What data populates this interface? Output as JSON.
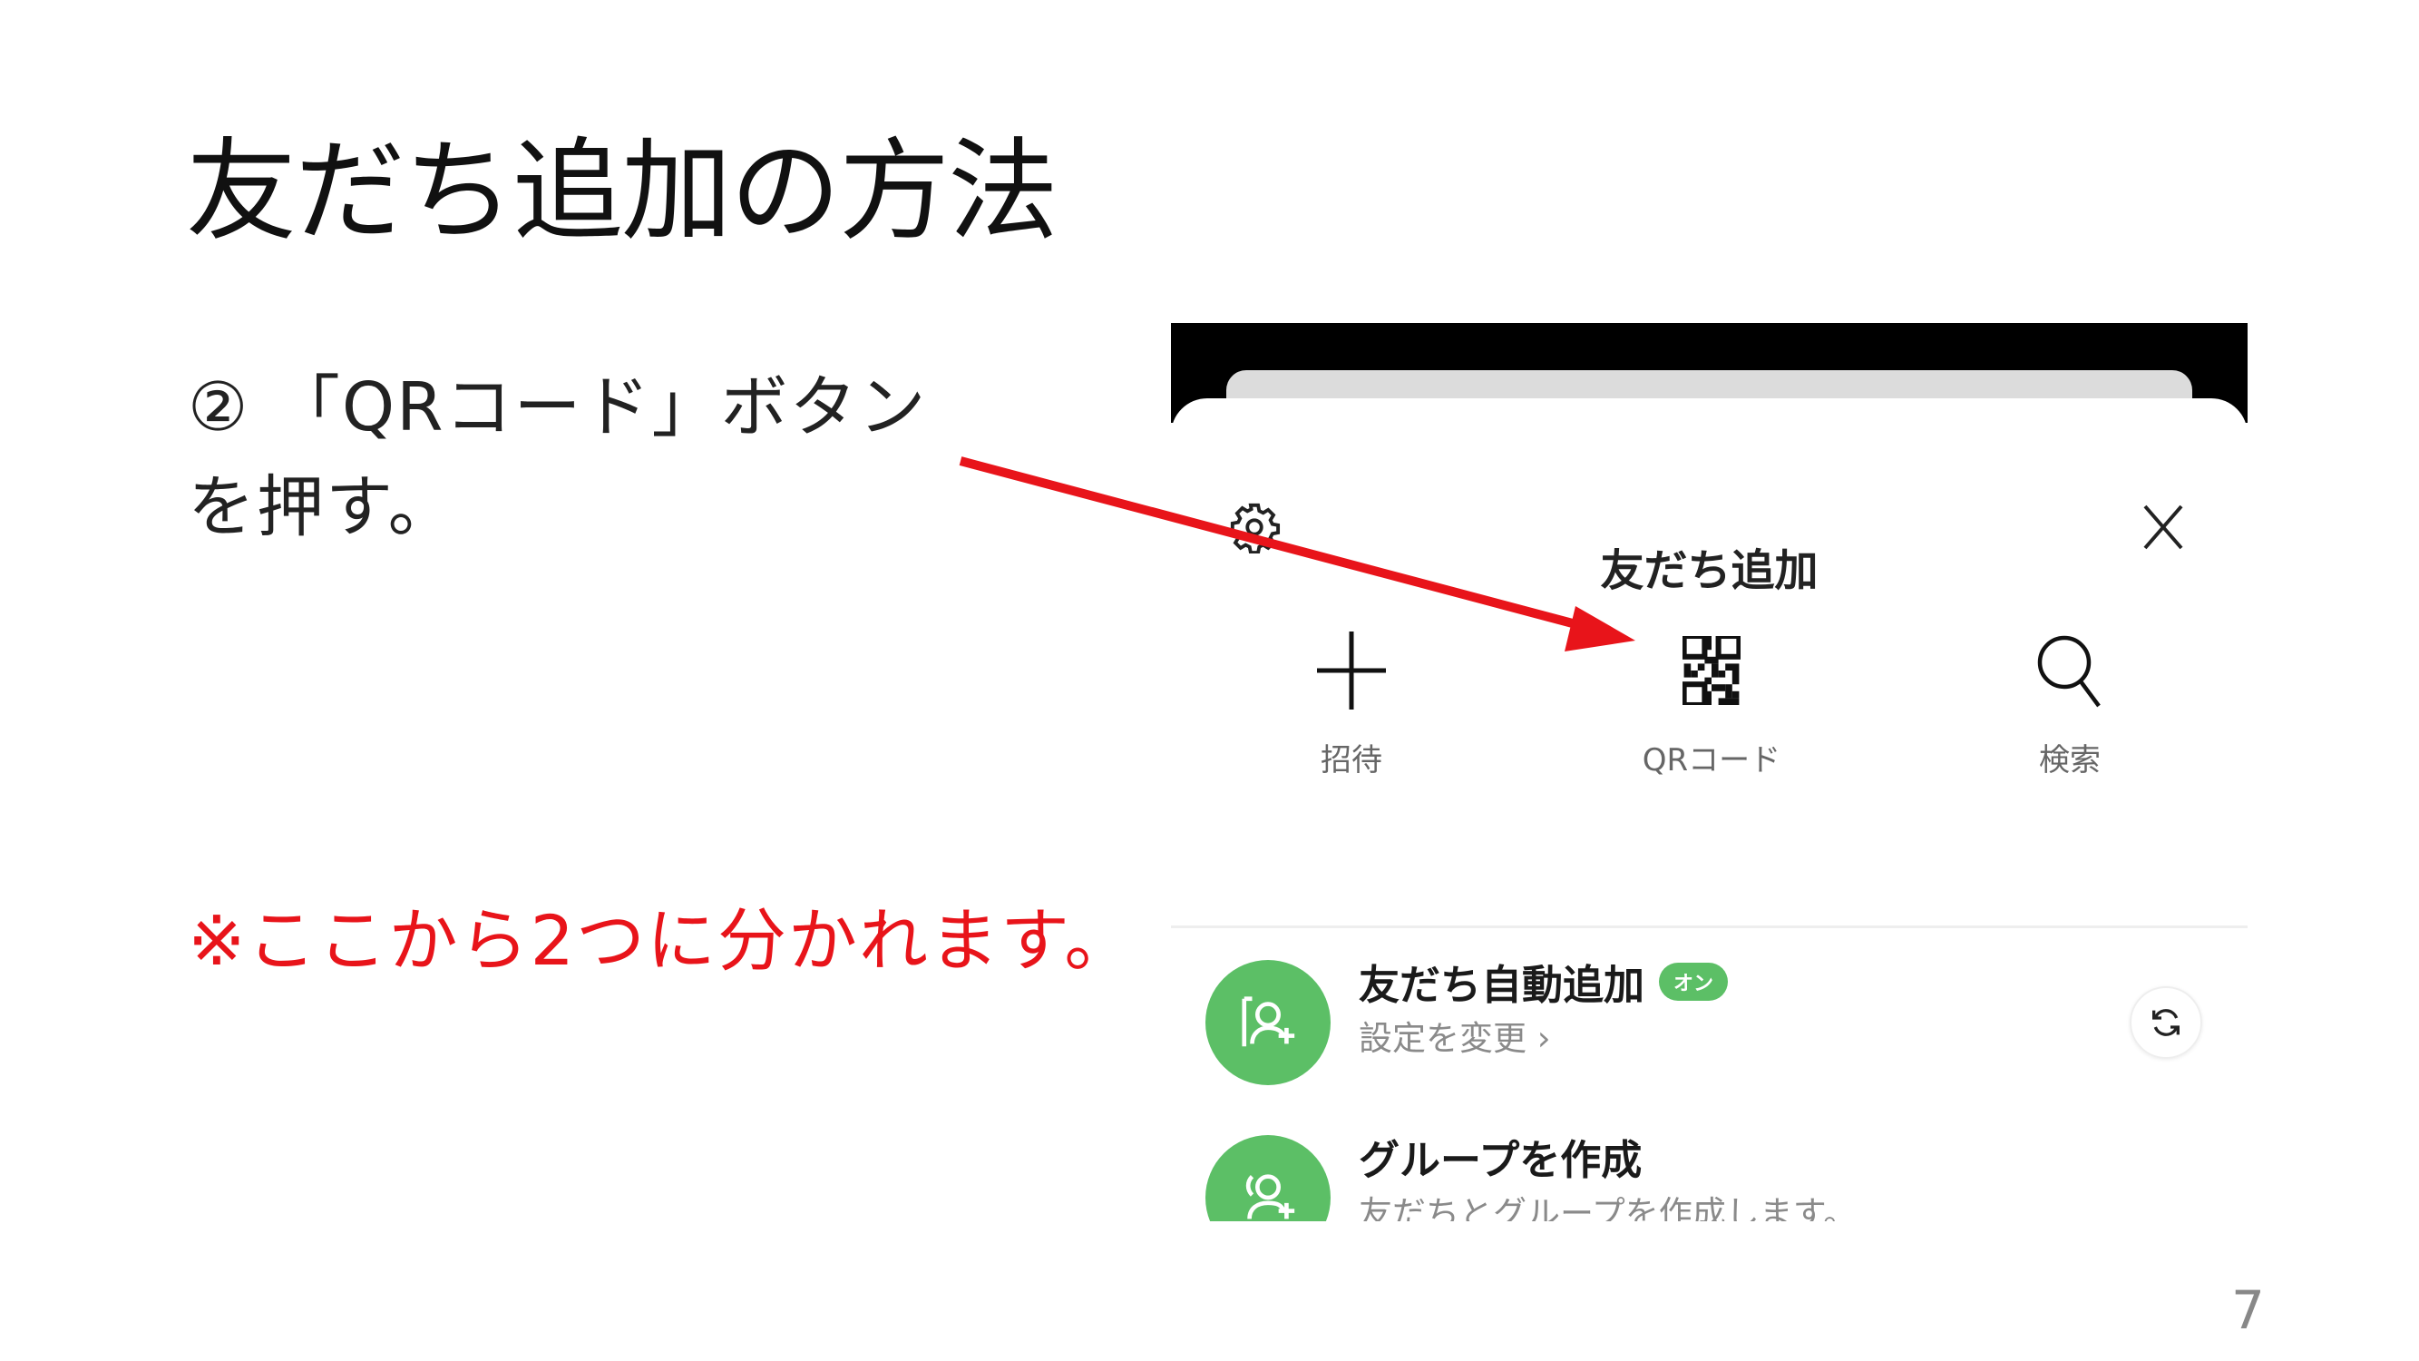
{
  "slide": {
    "title": "友だち追加の方法",
    "step_line1": "② 「QRコード」ボタン",
    "step_line2": "を押す。",
    "note": "※ここから2つに分かれます。",
    "page_number": "7",
    "accent_color": "#e8141a"
  },
  "phone": {
    "header": {
      "title": "友だち追加",
      "left_icon": "gear-icon",
      "right_icon": "close-icon"
    },
    "actions": [
      {
        "label": "招待",
        "icon": "plus-icon"
      },
      {
        "label": "QRコード",
        "icon": "qr-code-icon"
      },
      {
        "label": "検索",
        "icon": "search-icon"
      }
    ],
    "rows": [
      {
        "title": "友だち自動追加",
        "badge": "オン",
        "subtitle": "設定を変更 ›",
        "icon": "address-book-add-icon",
        "action_icon": "refresh-icon"
      },
      {
        "title": "グループを作成",
        "subtitle": "友だちとグループを作成します。",
        "icon": "group-add-icon"
      }
    ],
    "brand_color": "#5cbf66"
  }
}
